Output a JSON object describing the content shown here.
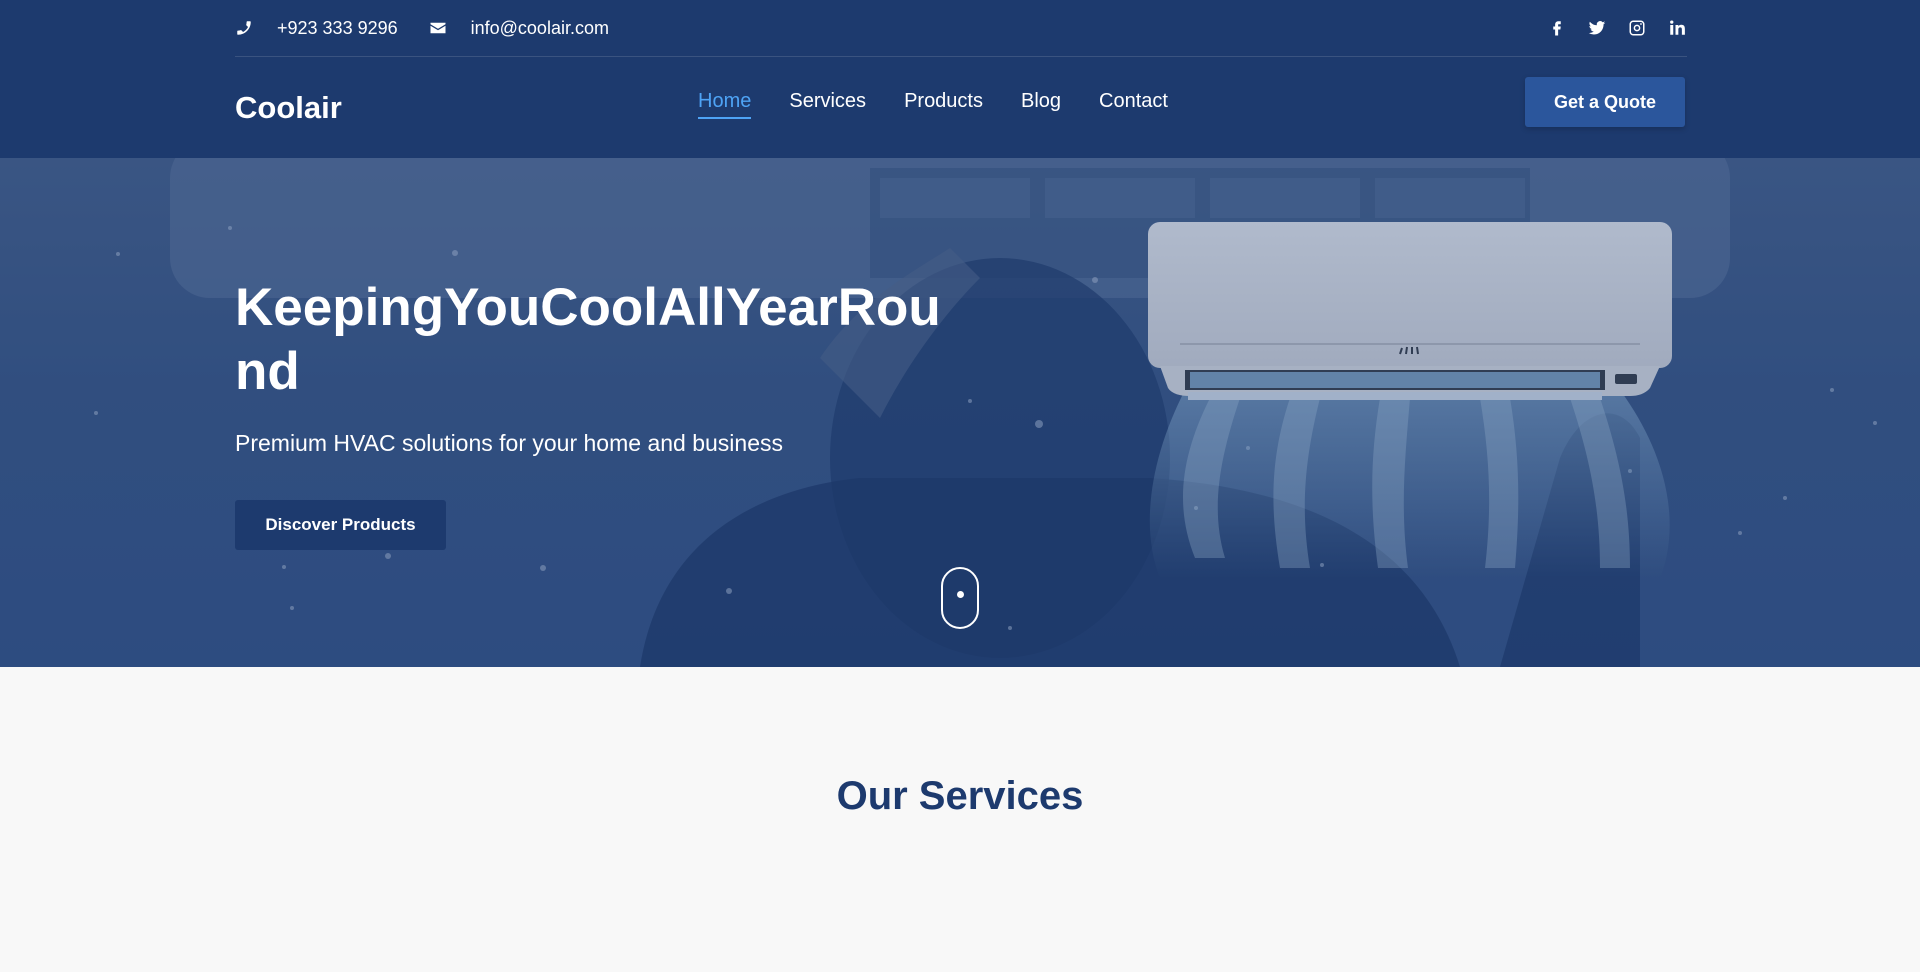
{
  "topbar": {
    "phone": "+923 333 9296",
    "email": "info@coolair.com",
    "phone_icon": "phone-icon",
    "email_icon": "envelope-icon",
    "socials": [
      "facebook-icon",
      "twitter-icon",
      "instagram-icon",
      "linkedin-icon"
    ]
  },
  "navbar": {
    "logo": "Coolair",
    "items": [
      {
        "label": "Home",
        "active": true
      },
      {
        "label": "Services",
        "active": false
      },
      {
        "label": "Products",
        "active": false
      },
      {
        "label": "Blog",
        "active": false
      },
      {
        "label": "Contact",
        "active": false
      }
    ],
    "quote_button": "Get a Quote"
  },
  "hero": {
    "title": "KeepingYouCoolAllYearRound",
    "subtitle": "Premium HVAC solutions for your home and business",
    "cta": "Discover Products"
  },
  "services": {
    "title": "Our Services"
  },
  "colors": {
    "primary": "#1d3a6e",
    "accent": "#4ea3f5",
    "button": "#2b569c",
    "background": "#f8f8f8"
  }
}
